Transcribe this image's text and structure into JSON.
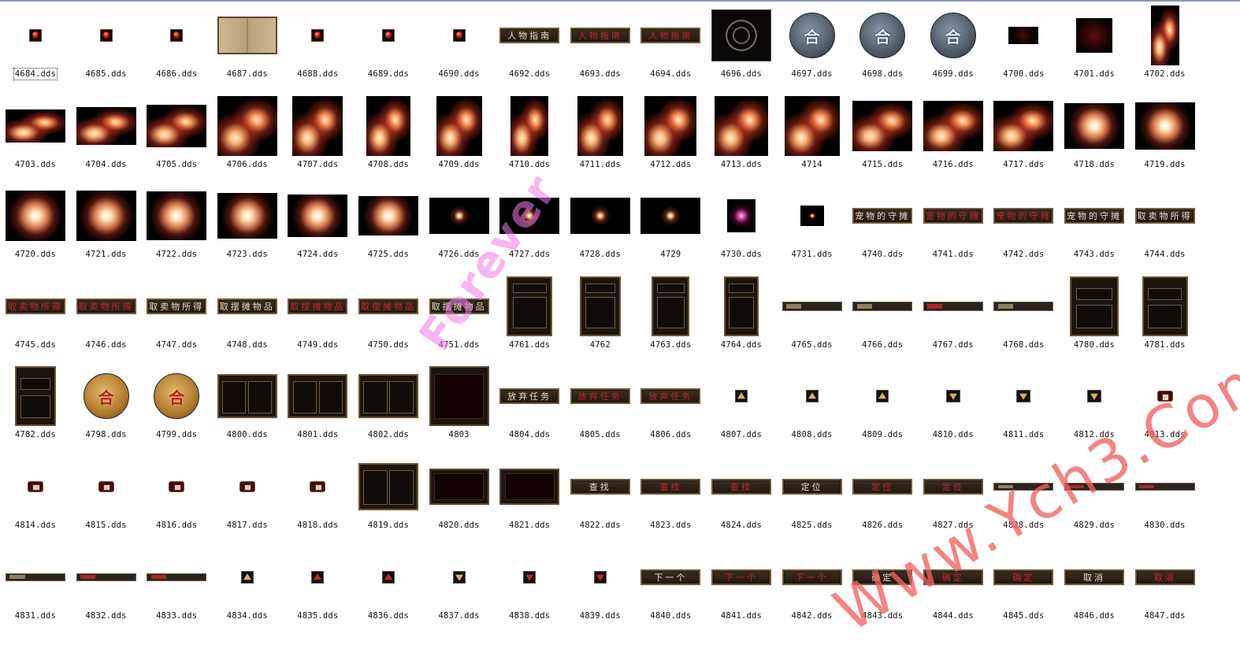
{
  "window": {
    "topline_color": "#8a97b3"
  },
  "watermarks": {
    "forever": "Forever",
    "site": "Www.Ych3.Com"
  },
  "items": [
    {
      "label": "4684.dds",
      "kind": "gem",
      "selected": true
    },
    {
      "label": "4685.dds",
      "kind": "gem"
    },
    {
      "label": "4686.dds",
      "kind": "gem"
    },
    {
      "label": "4687.dds",
      "kind": "book"
    },
    {
      "label": "4688.dds",
      "kind": "gem"
    },
    {
      "label": "4689.dds",
      "kind": "gem"
    },
    {
      "label": "4690.dds",
      "kind": "gem"
    },
    {
      "label": "4692.dds",
      "kind": "btn",
      "text": "人物指南",
      "tone": "light"
    },
    {
      "label": "4693.dds",
      "kind": "btn",
      "text": "人物指南",
      "tone": "red"
    },
    {
      "label": "4694.dds",
      "kind": "btn",
      "text": "人物指南",
      "tone": "red"
    },
    {
      "label": "4696.dds",
      "kind": "rune"
    },
    {
      "label": "4697.dds",
      "kind": "medal",
      "text": "合"
    },
    {
      "label": "4698.dds",
      "kind": "medal",
      "text": "合"
    },
    {
      "label": "4699.dds",
      "kind": "medal",
      "text": "合"
    },
    {
      "label": "4700.dds",
      "kind": "dark"
    },
    {
      "label": "4701.dds",
      "kind": "redblank"
    },
    {
      "label": "4702.dds",
      "kind": "fx"
    },
    {
      "label": "4703.dds",
      "kind": "fx"
    },
    {
      "label": "4704.dds",
      "kind": "fx"
    },
    {
      "label": "4705.dds",
      "kind": "fx"
    },
    {
      "label": "4706.dds",
      "kind": "fx"
    },
    {
      "label": "4707.dds",
      "kind": "fx"
    },
    {
      "label": "4708.dds",
      "kind": "fx"
    },
    {
      "label": "4709.dds",
      "kind": "fx"
    },
    {
      "label": "4710.dds",
      "kind": "fx"
    },
    {
      "label": "4711.dds",
      "kind": "fx"
    },
    {
      "label": "4712.dds",
      "kind": "fx"
    },
    {
      "label": "4713.dds",
      "kind": "fx"
    },
    {
      "label": "4714",
      "kind": "fx"
    },
    {
      "label": "4715.dds",
      "kind": "fx"
    },
    {
      "label": "4716.dds",
      "kind": "fx"
    },
    {
      "label": "4717.dds",
      "kind": "fx"
    },
    {
      "label": "4718.dds",
      "kind": "fx"
    },
    {
      "label": "4719.dds",
      "kind": "fx"
    },
    {
      "label": "4720.dds",
      "kind": "fx"
    },
    {
      "label": "4721.dds",
      "kind": "fx"
    },
    {
      "label": "4722.dds",
      "kind": "fx"
    },
    {
      "label": "4723.dds",
      "kind": "fx"
    },
    {
      "label": "4724.dds",
      "kind": "fx"
    },
    {
      "label": "4725.dds",
      "kind": "fx"
    },
    {
      "label": "4726.dds",
      "kind": "fx"
    },
    {
      "label": "4727.dds",
      "kind": "fx"
    },
    {
      "label": "4728.dds",
      "kind": "fx"
    },
    {
      "label": "4729",
      "kind": "fx"
    },
    {
      "label": "4730.dds",
      "kind": "fx"
    },
    {
      "label": "4731.dds",
      "kind": "fx"
    },
    {
      "label": "4740.dds",
      "kind": "btn",
      "text": "宠物的守摊",
      "tone": "light"
    },
    {
      "label": "4741.dds",
      "kind": "btn",
      "text": "宠物的守摊",
      "tone": "red"
    },
    {
      "label": "4742.dds",
      "kind": "btn",
      "text": "宠物的守摊",
      "tone": "red"
    },
    {
      "label": "4743.dds",
      "kind": "btn",
      "text": "宠物的守摊",
      "tone": "light"
    },
    {
      "label": "4744.dds",
      "kind": "btn",
      "text": "取卖物所得",
      "tone": "light"
    },
    {
      "label": "4745.dds",
      "kind": "btn",
      "text": "取卖物所得",
      "tone": "red"
    },
    {
      "label": "4746.dds",
      "kind": "btn",
      "text": "取卖物所得",
      "tone": "red"
    },
    {
      "label": "4747.dds",
      "kind": "btn",
      "text": "取卖物所得",
      "tone": "light"
    },
    {
      "label": "4748.dds",
      "kind": "btn",
      "text": "取摆摊物品",
      "tone": "light"
    },
    {
      "label": "4749.dds",
      "kind": "btn",
      "text": "取摆摊物品",
      "tone": "red"
    },
    {
      "label": "4750.dds",
      "kind": "btn",
      "text": "取摆摊物品",
      "tone": "red"
    },
    {
      "label": "4751.dds",
      "kind": "btn",
      "text": "取摆摊物品",
      "tone": "light"
    },
    {
      "label": "4761.dds",
      "kind": "panel"
    },
    {
      "label": "4762",
      "kind": "panel"
    },
    {
      "label": "4763.dds",
      "kind": "panel"
    },
    {
      "label": "4764.dds",
      "kind": "panel"
    },
    {
      "label": "4765.dds",
      "kind": "bar"
    },
    {
      "label": "4766.dds",
      "kind": "bar"
    },
    {
      "label": "4767.dds",
      "kind": "bar"
    },
    {
      "label": "4768.dds",
      "kind": "bar"
    },
    {
      "label": "4780.dds",
      "kind": "panel"
    },
    {
      "label": "4781.dds",
      "kind": "panel"
    },
    {
      "label": "4782.dds",
      "kind": "panel"
    },
    {
      "label": "4798.dds",
      "kind": "medal",
      "text": "合",
      "tone": "gold"
    },
    {
      "label": "4799.dds",
      "kind": "medal",
      "text": "合",
      "tone": "gold"
    },
    {
      "label": "4800.dds",
      "kind": "panel"
    },
    {
      "label": "4801.dds",
      "kind": "panel"
    },
    {
      "label": "4802.dds",
      "kind": "panel"
    },
    {
      "label": "4803",
      "kind": "frame"
    },
    {
      "label": "4804.dds",
      "kind": "btn",
      "text": "放弃任务",
      "tone": "light"
    },
    {
      "label": "4805.dds",
      "kind": "btn",
      "text": "放弃任务",
      "tone": "red"
    },
    {
      "label": "4806.dds",
      "kind": "btn",
      "text": "放弃任务",
      "tone": "red"
    },
    {
      "label": "4807.dds",
      "kind": "arrow"
    },
    {
      "label": "4808.dds",
      "kind": "arrow"
    },
    {
      "label": "4809.dds",
      "kind": "arrow"
    },
    {
      "label": "4810.dds",
      "kind": "arrow",
      "tone": "down"
    },
    {
      "label": "4811.dds",
      "kind": "arrow",
      "tone": "down"
    },
    {
      "label": "4812.dds",
      "kind": "arrow",
      "tone": "down"
    },
    {
      "label": "4813.dds",
      "kind": "icon"
    },
    {
      "label": "4814.dds",
      "kind": "icon"
    },
    {
      "label": "4815.dds",
      "kind": "icon"
    },
    {
      "label": "4816.dds",
      "kind": "icon"
    },
    {
      "label": "4817.dds",
      "kind": "icon"
    },
    {
      "label": "4818.dds",
      "kind": "icon"
    },
    {
      "label": "4819.dds",
      "kind": "panel"
    },
    {
      "label": "4820.dds",
      "kind": "frame"
    },
    {
      "label": "4821.dds",
      "kind": "frame"
    },
    {
      "label": "4822.dds",
      "kind": "btn",
      "text": "查找",
      "tone": "light"
    },
    {
      "label": "4823.dds",
      "kind": "btn",
      "text": "查找",
      "tone": "red"
    },
    {
      "label": "4824.dds",
      "kind": "btn",
      "text": "查找",
      "tone": "red"
    },
    {
      "label": "4825.dds",
      "kind": "btn",
      "text": "定位",
      "tone": "light"
    },
    {
      "label": "4826.dds",
      "kind": "btn",
      "text": "定位",
      "tone": "red"
    },
    {
      "label": "4827.dds",
      "kind": "btn",
      "text": "定位",
      "tone": "red"
    },
    {
      "label": "4828.dds",
      "kind": "bar"
    },
    {
      "label": "4829.dds",
      "kind": "bar"
    },
    {
      "label": "4830.dds",
      "kind": "bar"
    },
    {
      "label": "4831.dds",
      "kind": "bar"
    },
    {
      "label": "4832.dds",
      "kind": "bar"
    },
    {
      "label": "4833.dds",
      "kind": "bar"
    },
    {
      "label": "4834.dds",
      "kind": "arrow"
    },
    {
      "label": "4835.dds",
      "kind": "arrow",
      "tone": "red"
    },
    {
      "label": "4836.dds",
      "kind": "arrow",
      "tone": "red"
    },
    {
      "label": "4837.dds",
      "kind": "arrow",
      "tone": "down"
    },
    {
      "label": "4838.dds",
      "kind": "arrow",
      "tone": "down-red"
    },
    {
      "label": "4839.dds",
      "kind": "arrow",
      "tone": "down-red"
    },
    {
      "label": "4840.dds",
      "kind": "btn",
      "text": "下一个",
      "tone": "light"
    },
    {
      "label": "4841.dds",
      "kind": "btn",
      "text": "下一个",
      "tone": "red"
    },
    {
      "label": "4842.dds",
      "kind": "btn",
      "text": "下一个",
      "tone": "red"
    },
    {
      "label": "4843.dds",
      "kind": "btn",
      "text": "确定",
      "tone": "light"
    },
    {
      "label": "4844.dds",
      "kind": "btn",
      "text": "确定",
      "tone": "red"
    },
    {
      "label": "4845.dds",
      "kind": "btn",
      "text": "确定",
      "tone": "red"
    },
    {
      "label": "4846.dds",
      "kind": "btn",
      "text": "取消",
      "tone": "light"
    },
    {
      "label": "4847.dds",
      "kind": "btn",
      "text": "取消",
      "tone": "red"
    }
  ]
}
